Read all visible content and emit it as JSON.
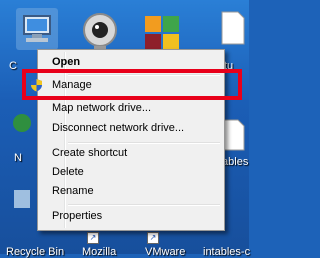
{
  "desktop": {
    "icons": [
      {
        "label": "C"
      },
      {
        "label": "N"
      },
      {
        "label": "tu"
      },
      {
        "label": "tables"
      },
      {
        "label": "Recycle Bin"
      },
      {
        "label": "Mozilla"
      },
      {
        "label": "VMware"
      },
      {
        "label": "intables-c"
      }
    ]
  },
  "context_menu": {
    "items": [
      {
        "label": "Open"
      },
      {
        "label": "Manage"
      },
      {
        "label": "Map network drive..."
      },
      {
        "label": "Disconnect network drive..."
      },
      {
        "label": "Create shortcut"
      },
      {
        "label": "Delete"
      },
      {
        "label": "Rename"
      },
      {
        "label": "Properties"
      }
    ],
    "highlight_color": "#e8001a"
  }
}
